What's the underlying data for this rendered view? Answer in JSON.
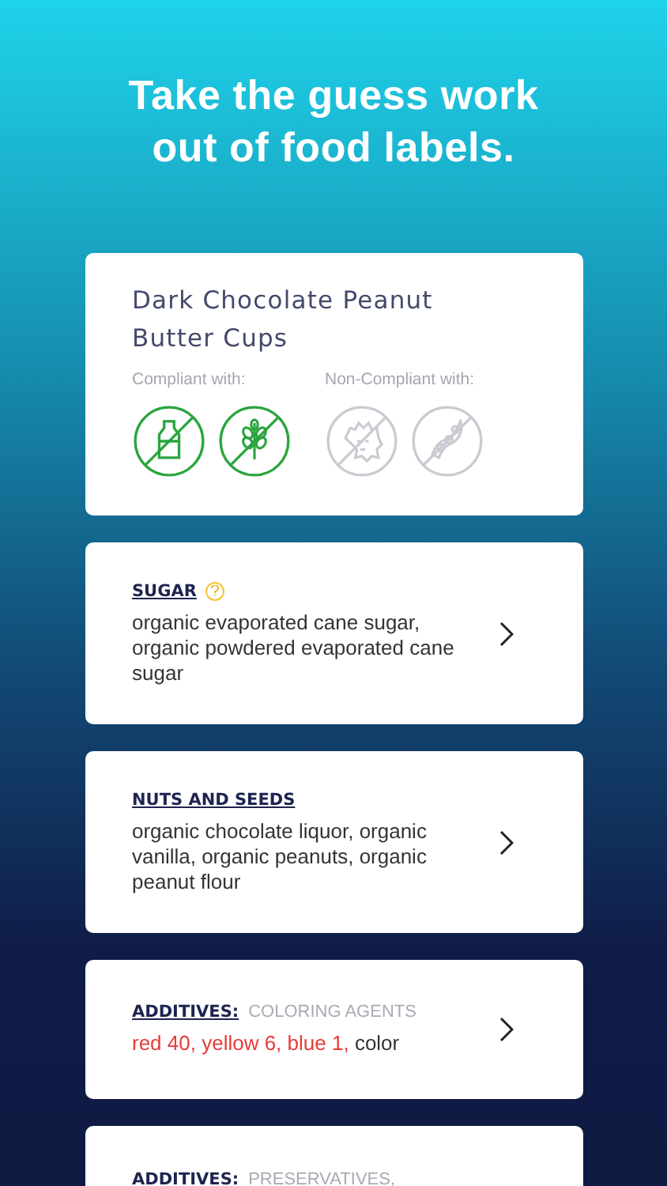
{
  "headline": "Take the guess work out of food labels.",
  "product": {
    "name": "Dark Chocolate Peanut Butter Cups",
    "compliant_label": "Compliant with:",
    "noncompliant_label": "Non-Compliant with:",
    "diets": [
      {
        "kind": "dairy",
        "compliant": true
      },
      {
        "kind": "gluten",
        "compliant": true
      },
      {
        "kind": "paleo",
        "compliant": false
      },
      {
        "kind": "soy",
        "compliant": false
      }
    ]
  },
  "ingredients": [
    {
      "category": "SUGAR",
      "info": true,
      "segments": [
        {
          "text": "organic evaporated cane sugar, organic powdered evaporated cane sugar",
          "flagged": false
        }
      ]
    },
    {
      "category": "NUTS AND SEEDS",
      "segments": [
        {
          "text": "organic chocolate liquor, organic vanilla, organic peanuts, organic peanut flour",
          "flagged": false
        }
      ]
    },
    {
      "category": "ADDITIVES:",
      "subcategory": "COLORING AGENTS",
      "segments": [
        {
          "text": "red 40, yellow 6, blue 1,",
          "flagged": true
        },
        {
          "text": "color",
          "flagged": false
        }
      ]
    },
    {
      "category": "ADDITIVES:",
      "subcategory": "PRESERVATIVES,"
    }
  ]
}
